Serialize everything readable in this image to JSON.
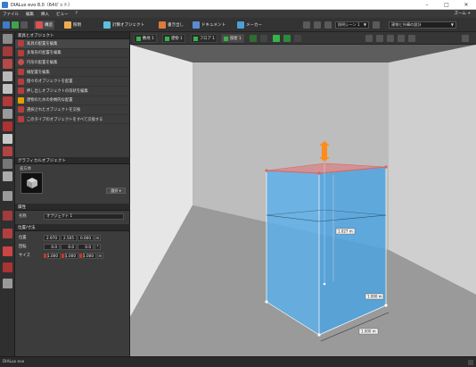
{
  "window": {
    "title": "DIALux evo 8.0（64ビット）",
    "controls": [
      "–",
      "□",
      "✕"
    ]
  },
  "menu": {
    "items": [
      "ファイル",
      "編集",
      "挿入",
      "ビュー",
      "?"
    ],
    "right_label": "ズーム +"
  },
  "toolbar": {
    "buttons": [
      {
        "label": "構造",
        "icon": "construction-icon",
        "color": "#d9534f"
      },
      {
        "label": "照明",
        "icon": "light-icon",
        "color": "#f0ad4e"
      },
      {
        "label": "計算オブジェクト",
        "icon": "calc-object-icon",
        "color": "#5bc0de"
      },
      {
        "label": "書き出し",
        "icon": "export-icon",
        "color": "#e07b39"
      },
      {
        "label": "ドキュメント",
        "icon": "document-icon",
        "color": "#5b8bd5"
      },
      {
        "label": "メーカー",
        "icon": "manufacturer-icon",
        "color": "#4aa0d8"
      }
    ],
    "scene_select": "照明シーン 1",
    "outdoor_select": "建物と外構の設計"
  },
  "left_panel": {
    "section_title": "家具とオブジェクト",
    "items": [
      "家具の配置を編集",
      "多角形の配置を編集",
      "円形の配置を編集",
      "線配置を編集",
      "個々のオブジェクトを配置",
      "押し出しオブジェクトの形状を編集",
      "建物のための余剰的な配置",
      "選択されたオブジェクトを交換",
      "このタイプのオブジェクトをすべて交換する"
    ],
    "graphic_title": "グラフィカルオブジェクト",
    "graphic_subtitle": "直方体",
    "select_button": "選択",
    "attributes_title": "属性",
    "name_label": "名称",
    "name_value": "オブジェクト 1",
    "position_title": "位置/寸法",
    "position_label": "位置",
    "position_values": [
      "2.970",
      "2.505",
      "0.000"
    ],
    "rotation_label": "回転",
    "rotation_values": [
      "0.0",
      "0.0",
      "0.0"
    ],
    "size_label": "サイズ",
    "size_values": [
      "1.000",
      "1.000",
      "1.000"
    ],
    "unit_m": "m",
    "unit_deg": "°"
  },
  "view_toolbar": {
    "tabs": [
      "敷地 1",
      "建物 1",
      "フロア 1",
      "部屋 1"
    ]
  },
  "viewport": {
    "dim_height": "1.027 m",
    "dim_depth": "1.000 m",
    "dim_width": "1.000 m",
    "object_color": "#5ab0ec",
    "selection_color": "#e06060",
    "handle_color": "#ff8c1a"
  },
  "status": {
    "text": "DIALux evo"
  }
}
